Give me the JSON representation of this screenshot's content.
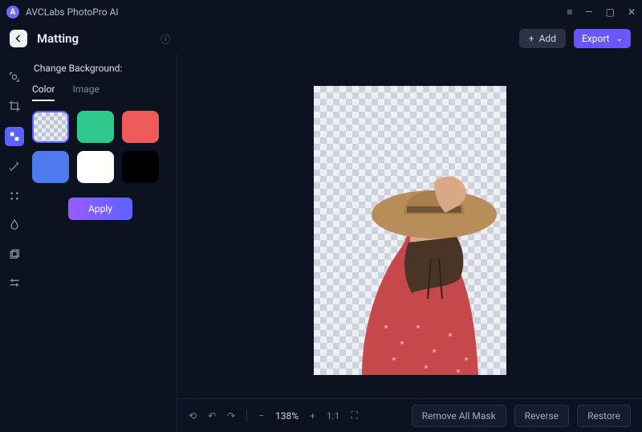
{
  "app": {
    "name": "AVCLabs PhotoPro AI"
  },
  "header": {
    "page_title": "Matting",
    "add_label": "Add",
    "export_label": "Export"
  },
  "sidebar": {
    "section_label": "Change Background:",
    "tabs": {
      "color": "Color",
      "image": "Image",
      "active": "color"
    },
    "swatches": [
      {
        "name": "transparent",
        "color": "transparent",
        "selected": true
      },
      {
        "name": "emerald",
        "color": "#2fc98b"
      },
      {
        "name": "coral",
        "color": "#ef5a5a"
      },
      {
        "name": "blue",
        "color": "#4e7af0"
      },
      {
        "name": "white",
        "color": "#ffffff"
      },
      {
        "name": "black",
        "color": "#000000"
      }
    ],
    "apply_label": "Apply"
  },
  "tools": [
    {
      "name": "change-bg-icon"
    },
    {
      "name": "crop-icon"
    },
    {
      "name": "bg-swap-icon",
      "active": true
    },
    {
      "name": "magic-wand-icon"
    },
    {
      "name": "ai-tools-icon"
    },
    {
      "name": "color-adjust-icon"
    },
    {
      "name": "layers-icon"
    },
    {
      "name": "sliders-icon"
    }
  ],
  "bottombar": {
    "zoom": "138%",
    "ratio_label": "1:1",
    "remove_all_label": "Remove All Mask",
    "reverse_label": "Reverse",
    "restore_label": "Restore"
  },
  "canvas": {
    "subject": "woman wearing sun hat, red patterned blouse, arm raised to hat brim",
    "background": "transparent"
  }
}
